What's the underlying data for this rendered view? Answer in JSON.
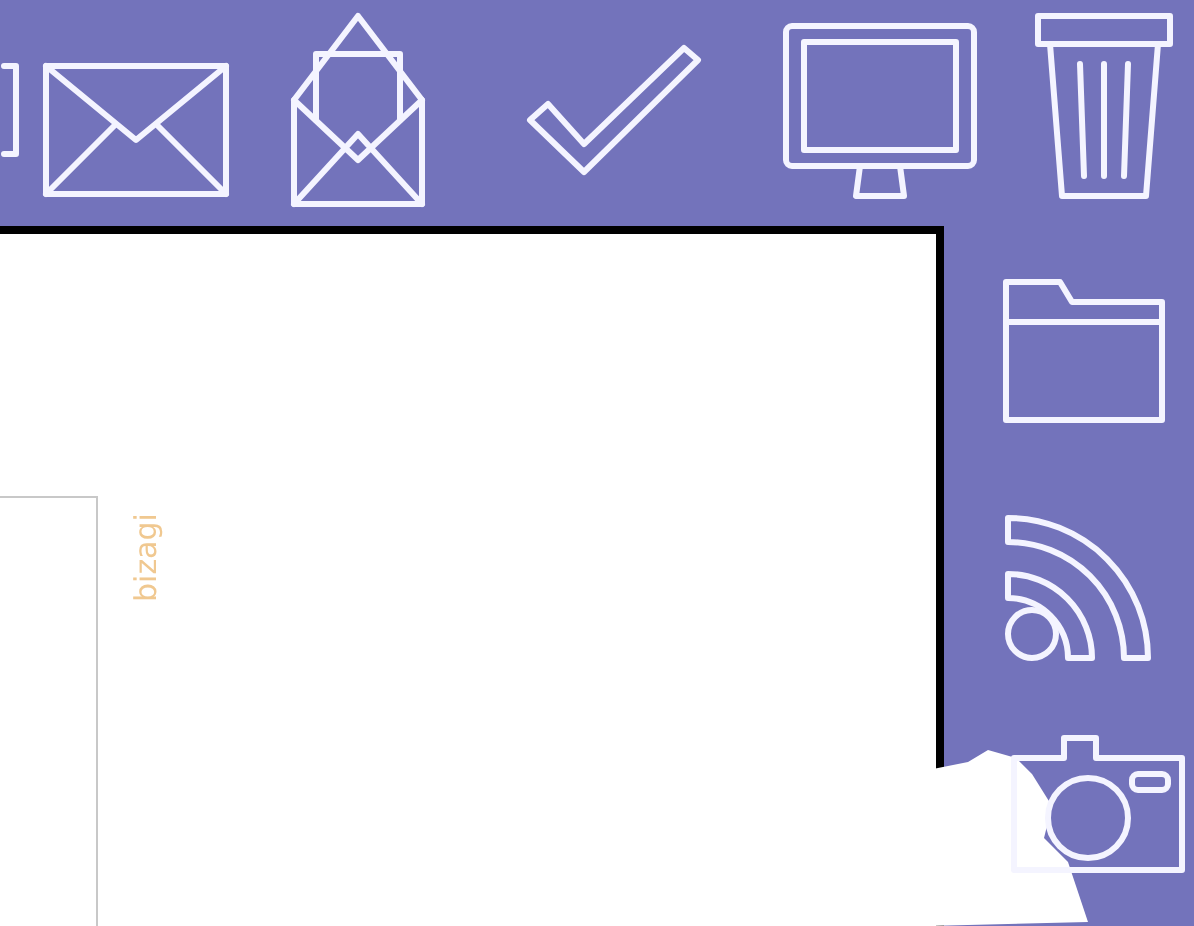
{
  "document": {
    "logo": "bizagi"
  }
}
